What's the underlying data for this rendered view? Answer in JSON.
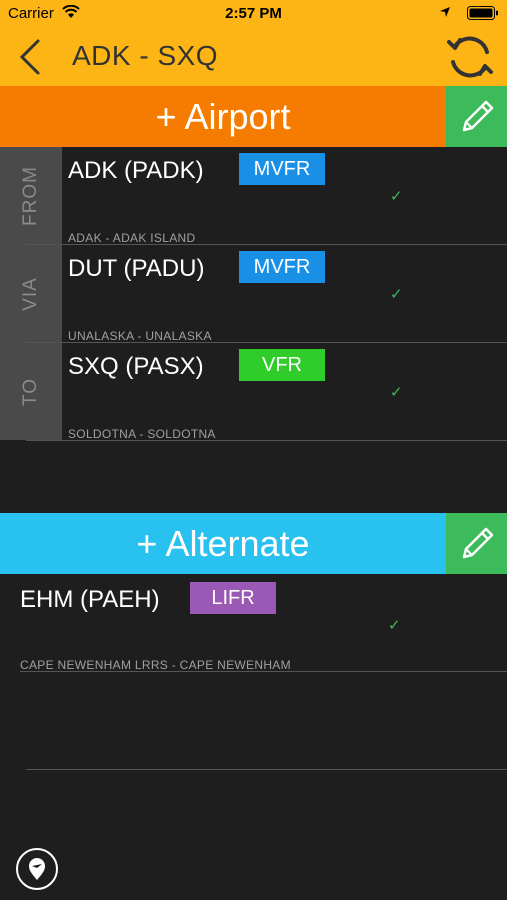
{
  "status_bar": {
    "carrier": "Carrier",
    "time": "2:57 PM"
  },
  "nav": {
    "title": "ADK - SXQ"
  },
  "airport_section": {
    "header": "+ Airport",
    "side_labels": [
      "FROM",
      "VIA",
      "TO"
    ],
    "rows": [
      {
        "code": "ADK (PADK)",
        "category": "MVFR",
        "category_color": "#1a8fe6",
        "name": "ADAK - ADAK ISLAND",
        "check": "✓"
      },
      {
        "code": "DUT (PADU)",
        "category": "MVFR",
        "category_color": "#1a8fe6",
        "name": "UNALASKA - UNALASKA",
        "check": "✓"
      },
      {
        "code": "SXQ (PASX)",
        "category": "VFR",
        "category_color": "#2fcc2a",
        "name": "SOLDOTNA - SOLDOTNA",
        "check": "✓"
      }
    ]
  },
  "alternate_section": {
    "header": "+ Alternate",
    "rows": [
      {
        "code": "EHM (PAEH)",
        "category": "LIFR",
        "category_color": "#9b59b6",
        "name": "CAPE NEWENHAM LRRS - CAPE NEWENHAM",
        "check": "✓"
      }
    ]
  },
  "colors": {
    "nav_bar": "#fdb515",
    "airport_header": "#f57c00",
    "alternate_header": "#29c1ef",
    "edit_button": "#3dba5a",
    "background": "#1e1e1e"
  },
  "icons": {
    "back": "chevron-left-icon",
    "refresh": "refresh-icon",
    "edit": "pencil-icon",
    "map": "map-pin-icon"
  }
}
